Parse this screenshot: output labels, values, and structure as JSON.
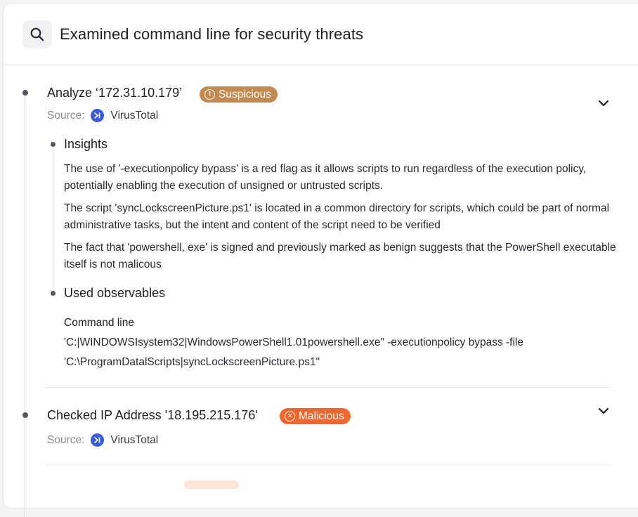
{
  "header": {
    "title": "Examined command line for security threats",
    "icon": "search-icon"
  },
  "steps": [
    {
      "title": "Analyze ‘172.31.10.179’",
      "badge": {
        "label": "Suspicious",
        "color": "#c38a4f",
        "icon": "alert-circle-icon"
      },
      "source_label": "Source:",
      "source_name": "VirusTotal",
      "expanded": true,
      "insights_title": "Insights",
      "insights": [
        "The use of '-executionpolicy bypass' is a red flag as it allows scripts to run regardless of the execution policy, potentially enabling the execution of unsigned or untrusted scripts.",
        "The script 'syncLockscreenPicture.ps1' is located in a common directory for scripts, which could be part of normal administrative tasks, but the intent and content of the script need to be verified",
        "The fact that 'powershell, exe' is signed and previously marked as benign suggests that the PowerShell executable itself is not malicous"
      ],
      "observables_title": "Used observables",
      "command_label": "Command line",
      "command_lines": [
        "'C:|WINDOWSIsystem32|WindowsPowerShell1.01powershell.exe\" -executionpolicy bypass -file",
        "'C:\\ProgramDatalScripts|syncLockscreenPicture.ps1\""
      ]
    },
    {
      "title": "Checked IP Address '18.195.215.176'",
      "badge": {
        "label": "Malicious",
        "color": "#f2662d",
        "icon": "x-circle-icon"
      },
      "source_label": "Source:",
      "source_name": "VirusTotal",
      "expanded": false
    }
  ]
}
